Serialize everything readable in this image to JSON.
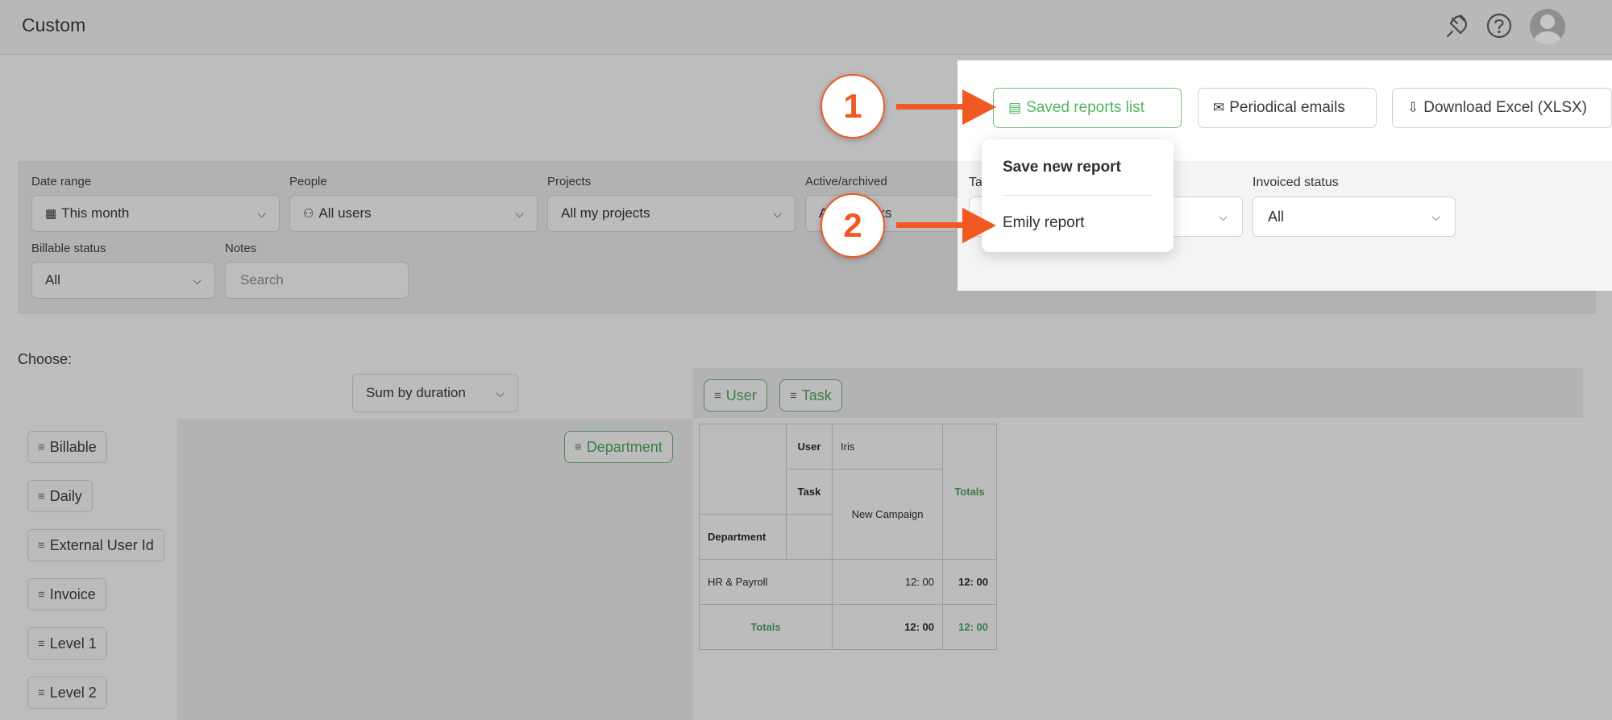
{
  "header": {
    "title": "Custom",
    "icons": [
      "plug-icon",
      "help-icon",
      "avatar"
    ]
  },
  "filters": {
    "date_range": {
      "label": "Date range",
      "value": "This month"
    },
    "people": {
      "label": "People",
      "value": "All users"
    },
    "projects": {
      "label": "Projects",
      "value": "All my projects"
    },
    "active_archived": {
      "label": "Active/archived",
      "value_left": "A",
      "value_right": "ks"
    },
    "tasks": {
      "label_fragment": "Ta"
    },
    "invoiced_status": {
      "label": "Invoiced status",
      "value": "All"
    },
    "billable_status": {
      "label": "Billable status",
      "value": "All"
    },
    "notes": {
      "label": "Notes",
      "placeholder": "Search"
    }
  },
  "choose": {
    "label": "Choose:",
    "sum_by": "Sum by duration",
    "available_fields": [
      "Billable",
      "Daily",
      "External User Id",
      "Invoice",
      "Level 1",
      "Level 2"
    ],
    "row_field": "Department",
    "column_fields": [
      "User",
      "Task"
    ]
  },
  "pivot": {
    "header_user_label": "User",
    "header_user_value": "Iris",
    "header_task_label": "Task",
    "header_task_value": "New Campaign",
    "totals_col_label": "Totals",
    "department_label": "Department",
    "rows": [
      {
        "label": "HR & Payroll",
        "value": "12: 00",
        "total": "12: 00"
      }
    ],
    "totals_row": {
      "label": "Totals",
      "value": "12: 00",
      "total": "12: 00"
    }
  },
  "panel": {
    "saved_reports_button": "Saved reports list",
    "periodical_emails_button": "Periodical emails",
    "download_button": "Download Excel (XLSX)",
    "menu": {
      "save_new": "Save new report",
      "saved_item": "Emily report"
    }
  },
  "annotations": {
    "step1": "1",
    "step2": "2",
    "accent": "#f05a22"
  },
  "colors": {
    "green": "#54b55f"
  }
}
